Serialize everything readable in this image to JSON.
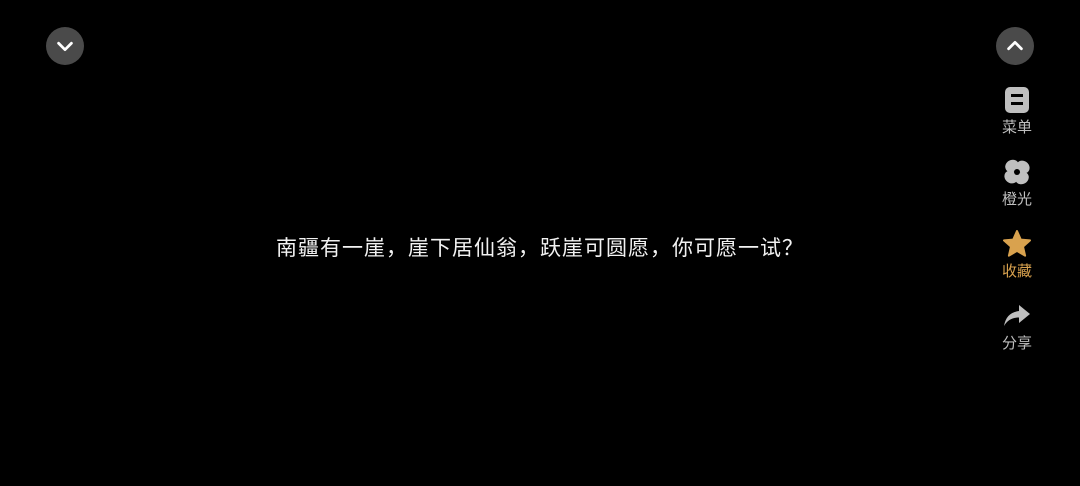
{
  "dialogue": {
    "text": "南疆有一崖，崖下居仙翁，跃崖可圆愿，你可愿一试？"
  },
  "controls": {
    "collapse_icon": "chevron-down-icon",
    "expand_icon": "chevron-up-icon"
  },
  "side_menu": {
    "items": [
      {
        "label": "菜单",
        "icon": "menu-icon"
      },
      {
        "label": "橙光",
        "icon": "orange-light-logo-icon"
      },
      {
        "label": "收藏",
        "icon": "star-icon",
        "color": "#d9a24e"
      },
      {
        "label": "分享",
        "icon": "share-icon"
      }
    ]
  },
  "colors": {
    "background": "#000000",
    "button_bg": "#4a4a4a",
    "icon_gray": "#bfbfbf",
    "accent_gold": "#d9a24e"
  }
}
